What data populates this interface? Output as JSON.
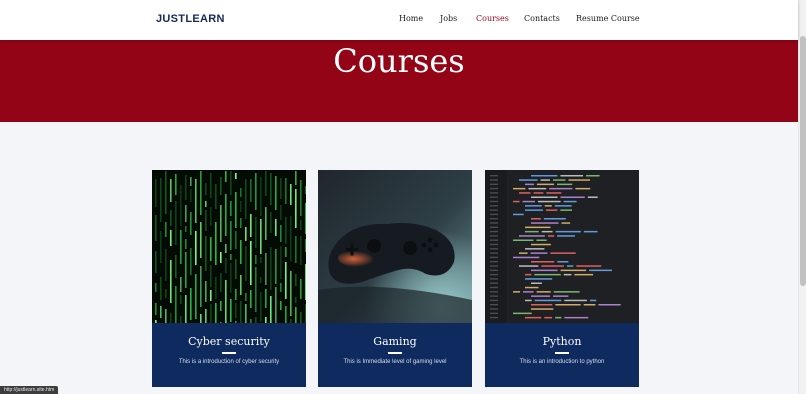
{
  "brand": "JUSTLEARN",
  "nav": {
    "home": "Home",
    "jobs": "Jobs",
    "courses": "Courses",
    "contacts": "Contacts",
    "resume": "Resume Course",
    "active": "Courses"
  },
  "hero": {
    "title": "Courses"
  },
  "courses": [
    {
      "title": "Cyber security",
      "description": "This is a introduction of cyber security",
      "image": "matrix-code-image"
    },
    {
      "title": "Gaming",
      "description": "This is Immediate level of gaming level",
      "image": "game-controller-image"
    },
    {
      "title": "Python",
      "description": "This is an introduction to python",
      "image": "code-editor-image"
    }
  ],
  "status_bar": {
    "url": "http://justlearn.site.htm"
  },
  "colors": {
    "brand": "#14285a",
    "accent": "#930516",
    "active_link": "#9b0619",
    "card_bg": "#0e2a5f",
    "page_bg": "#f4f5f9"
  }
}
